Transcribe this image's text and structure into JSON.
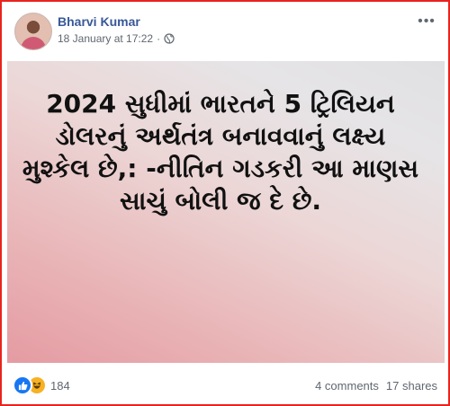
{
  "post": {
    "author": "Bharvi Kumar",
    "timestamp": "18 January at 17:22",
    "separator": "·",
    "privacy_icon": "globe-icon",
    "more_icon": "more-options-icon",
    "image_text": "2024 સુધીમાં ભારતને 5 ટ્રિલિયન ડોલરનું અર્થતંત્ર બનાવવાનું લક્ષ્ય મુશ્કેલ છે,: -નીતિન ગડકરી આ માણસ સાચું બોલી જ દે છે.",
    "image_background": [
      "#e49ba2",
      "#ecd6d6",
      "#e0e0e2"
    ]
  },
  "footer": {
    "reaction_icons": [
      "like-icon",
      "haha-icon"
    ],
    "reaction_count": "184",
    "comments": "4 comments",
    "shares": "17 shares"
  },
  "colors": {
    "frame_border": "#e8231e",
    "author_link": "#385898",
    "meta_text": "#606770",
    "like_blue": "#1877f2",
    "haha_yellow": "#f7b125"
  }
}
